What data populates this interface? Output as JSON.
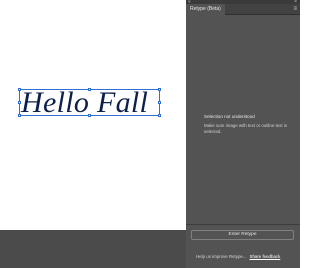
{
  "canvas": {
    "text": "Hello Fall"
  },
  "panel": {
    "tab_label": "Retype (Beta)",
    "topstrip_left": "«",
    "topstrip_right": "×",
    "menu_icon": "≡",
    "message_title": "Selection not understood",
    "message_body": "Make sure image with text or outline text is selected.",
    "enter_button": "Enter Retype",
    "footer_text": "Help us improve Retype...",
    "feedback_link": "Share feedback"
  },
  "colors": {
    "selection": "#2f6fd6",
    "panel_bg": "#535353",
    "bottom_bar": "#4b4b4b"
  }
}
